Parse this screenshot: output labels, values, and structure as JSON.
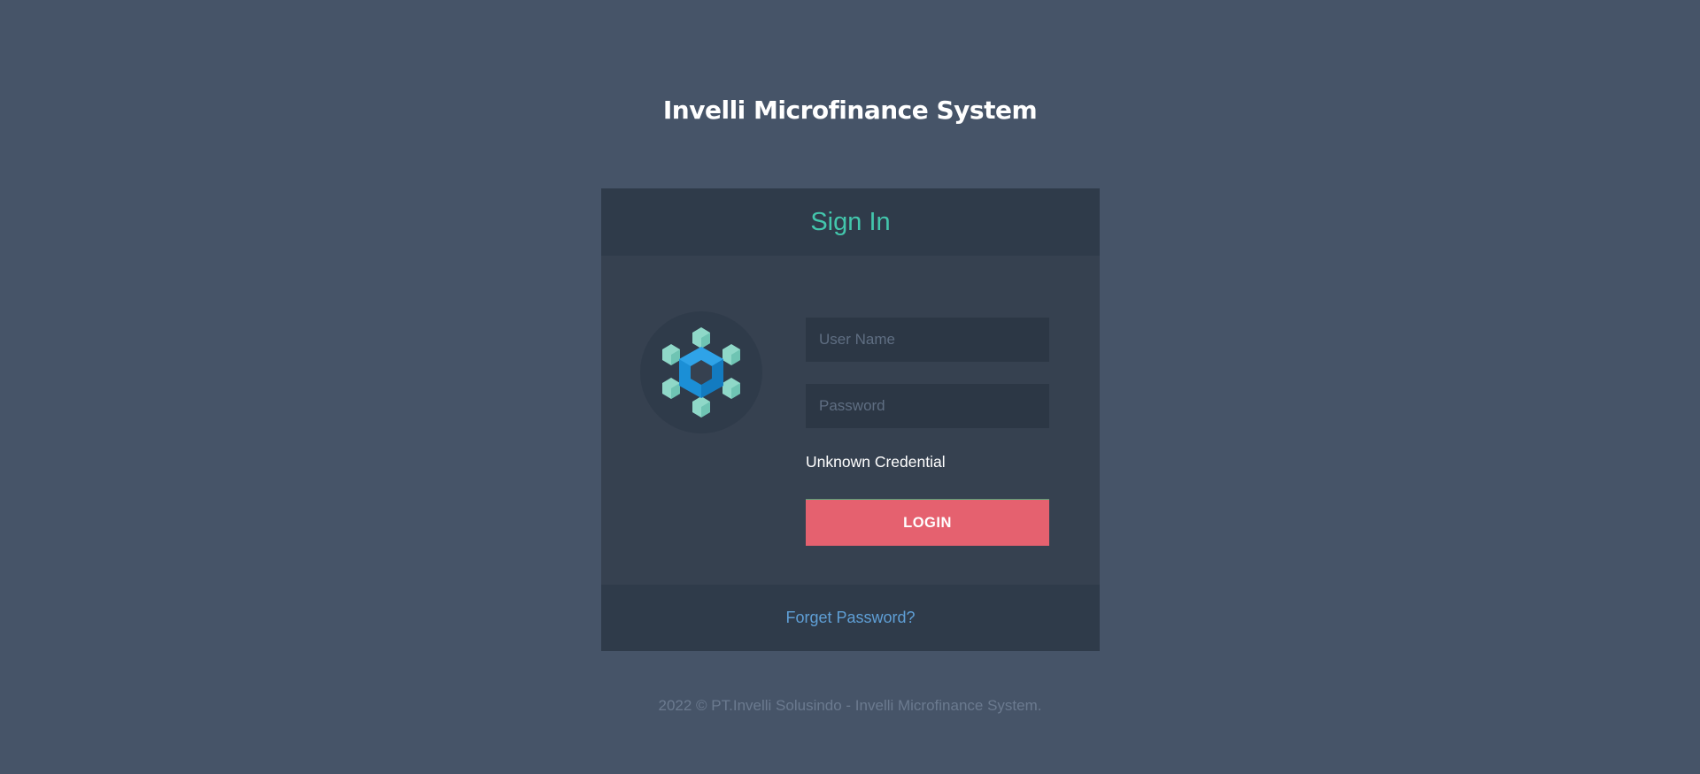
{
  "app": {
    "title": "Invelli Microfinance System"
  },
  "login_card": {
    "header": "Sign In",
    "logo_icon": "hexagon-cube-logo-icon",
    "username": {
      "placeholder": "User Name",
      "value": ""
    },
    "password": {
      "placeholder": "Password",
      "value": ""
    },
    "error_message": "Unknown Credential",
    "login_button_label": "LOGIN",
    "forgot_password_link": "Forget Password?"
  },
  "footer": {
    "copyright": "2022 © PT.Invelli Solusindo - Invelli Microfinance System."
  },
  "colors": {
    "background": "#465468",
    "card": "#364150",
    "card_header": "#2f3b4a",
    "accent_teal": "#43c6ac",
    "login_button": "#e5616f",
    "link": "#5f9fd6"
  }
}
